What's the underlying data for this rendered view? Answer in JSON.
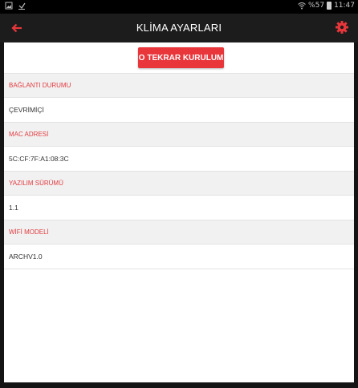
{
  "status_bar": {
    "battery_percent": "%57",
    "time": "11:47",
    "icons": [
      "gallery-icon",
      "download-icon",
      "wifi-icon",
      "battery-icon"
    ]
  },
  "app_bar": {
    "title": "KLİMA AYARLARI",
    "back_icon": "arrow-left-icon",
    "settings_icon": "gear-icon"
  },
  "actions": {
    "reset_icon": "O",
    "reset_label": "TEKRAR KURULUM"
  },
  "sections": [
    {
      "header": "BAĞLANTI DURUMU",
      "value": "ÇEVRİMİÇİ"
    },
    {
      "header": "MAC ADRESİ",
      "value": "5C:CF:7F:A1:08:3C"
    },
    {
      "header": "YAZILIM SÜRÜMÜ",
      "value": "1.1"
    },
    {
      "header": "WİFİ MODELİ",
      "value": "ARCHV1.0"
    }
  ],
  "colors": {
    "accent": "#e8363b",
    "app_bar": "#1c1c1c",
    "section_header_bg": "#f1f1f1"
  }
}
